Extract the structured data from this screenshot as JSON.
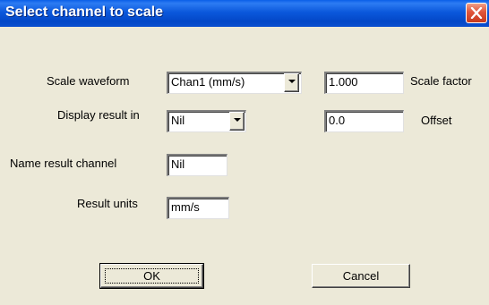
{
  "window": {
    "title": "Select channel to scale"
  },
  "form": {
    "scale_waveform_label": "Scale waveform",
    "scale_waveform_value": "Chan1 (mm/s)",
    "scale_factor_value": "1.000",
    "scale_factor_label": "Scale factor",
    "display_result_label": "Display result in",
    "display_result_value": "Nil",
    "offset_value": "0.0",
    "offset_label": "Offset",
    "name_result_label": "Name result channel",
    "name_result_value": "Nil",
    "result_units_label": "Result units",
    "result_units_value": "mm/s"
  },
  "buttons": {
    "ok_label": "OK",
    "cancel_label": "Cancel"
  },
  "icons": {
    "close": "close-icon",
    "dropdown": "chevron-down-icon"
  }
}
